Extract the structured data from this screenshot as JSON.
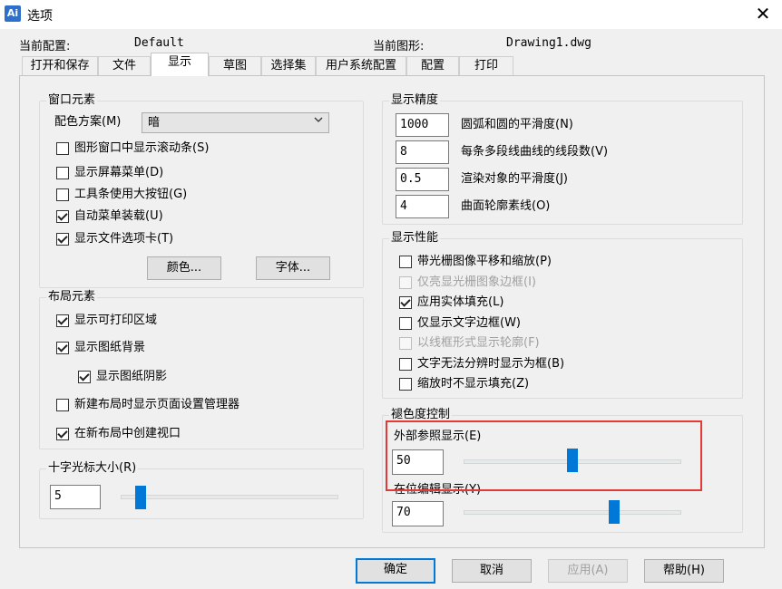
{
  "window": {
    "title": "选项",
    "app_icon_glyph": "Ai"
  },
  "header": {
    "current_profile_label": "当前配置:",
    "current_profile_value": "Default",
    "current_drawing_label": "当前图形:",
    "current_drawing_value": "Drawing1.dwg"
  },
  "tabs": [
    {
      "label": "打开和保存"
    },
    {
      "label": "文件"
    },
    {
      "label": "显示"
    },
    {
      "label": "草图"
    },
    {
      "label": "选择集"
    },
    {
      "label": "用户系统配置"
    },
    {
      "label": "配置"
    },
    {
      "label": "打印"
    }
  ],
  "window_elements": {
    "title": "窗口元素",
    "color_scheme_label": "配色方案(M)",
    "color_scheme_value": "暗",
    "checkboxes": [
      {
        "label": "图形窗口中显示滚动条(S)",
        "checked": false
      },
      {
        "label": "显示屏幕菜单(D)",
        "checked": false
      },
      {
        "label": "工具条使用大按钮(G)",
        "checked": false
      },
      {
        "label": "自动菜单装载(U)",
        "checked": true
      },
      {
        "label": "显示文件选项卡(T)",
        "checked": true
      }
    ],
    "colors_button": "颜色...",
    "fonts_button": "字体..."
  },
  "layout_elements": {
    "title": "布局元素",
    "checkboxes": [
      {
        "label": "显示可打印区域",
        "checked": true
      },
      {
        "label": "显示图纸背景",
        "checked": true
      },
      {
        "label": "显示图纸阴影",
        "checked": true
      },
      {
        "label": "新建布局时显示页面设置管理器",
        "checked": false
      },
      {
        "label": "在新布局中创建视口",
        "checked": true
      }
    ]
  },
  "crosshair": {
    "title": "十字光标大小(R)",
    "value": "5",
    "slider_fraction": 0.07
  },
  "display_resolution": {
    "title": "显示精度",
    "items": [
      {
        "value": "1000",
        "label": "圆弧和圆的平滑度(N)"
      },
      {
        "value": "8",
        "label": "每条多段线曲线的线段数(V)"
      },
      {
        "value": "0.5",
        "label": "渲染对象的平滑度(J)"
      },
      {
        "value": "4",
        "label": "曲面轮廓素线(O)"
      }
    ]
  },
  "display_performance": {
    "title": "显示性能",
    "checkboxes": [
      {
        "label": "带光栅图像平移和缩放(P)",
        "checked": false,
        "disabled": false
      },
      {
        "label": "仅亮显光栅图象边框(I)",
        "checked": false,
        "disabled": true
      },
      {
        "label": "应用实体填充(L)",
        "checked": true,
        "disabled": false
      },
      {
        "label": "仅显示文字边框(W)",
        "checked": false,
        "disabled": false
      },
      {
        "label": "以线框形式显示轮廓(F)",
        "checked": false,
        "disabled": true
      },
      {
        "label": "文字无法分辨时显示为框(B)",
        "checked": false,
        "disabled": false
      },
      {
        "label": "缩放时不显示填充(Z)",
        "checked": false,
        "disabled": false
      }
    ]
  },
  "fade_control": {
    "title": "褪色度控制",
    "xref_label": "外部参照显示(E)",
    "xref_value": "50",
    "xref_fraction": 0.5,
    "inplace_label": "在位编辑显示(Y)",
    "inplace_value": "70",
    "inplace_fraction": 0.7,
    "highlight_color": "#e53935"
  },
  "footer": {
    "ok": "确定",
    "cancel": "取消",
    "apply": "应用(A)",
    "help": "帮助(H)"
  },
  "colors": {
    "accent": "#0078d7",
    "window_bg": "#f0f0f0"
  }
}
